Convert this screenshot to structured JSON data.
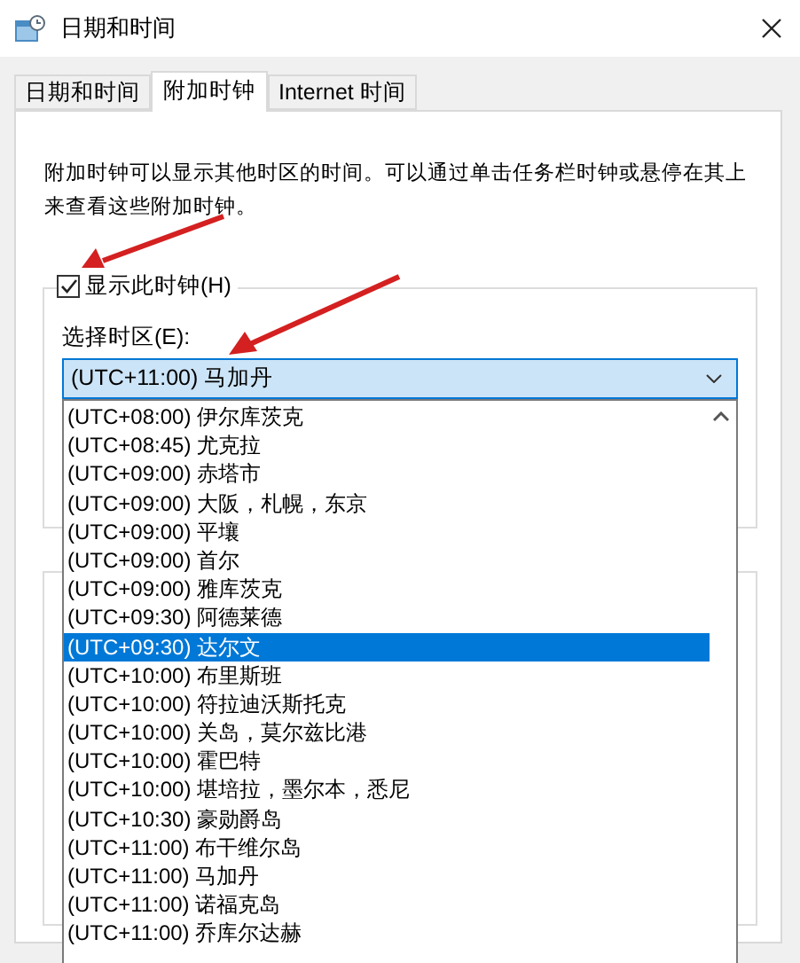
{
  "window": {
    "title": "日期和时间"
  },
  "tabs": [
    {
      "label": "日期和时间",
      "selected": false
    },
    {
      "label": "附加时钟",
      "selected": true
    },
    {
      "label": "Internet 时间",
      "selected": false
    }
  ],
  "description": "附加时钟可以显示其他时区的时间。可以通过单击任务栏时钟或悬停在其上来查看这些附加时钟。",
  "clock_group": {
    "checkbox": {
      "label": "显示此时钟(H)",
      "checked": true
    },
    "timezone_label": "选择时区(E):",
    "timezone_value": "(UTC+11:00) 马加丹"
  },
  "timezone_list": [
    {
      "label": "(UTC+08:00) 伊尔库茨克",
      "selected": false
    },
    {
      "label": "(UTC+08:45) 尤克拉",
      "selected": false
    },
    {
      "label": "(UTC+09:00) 赤塔市",
      "selected": false
    },
    {
      "label": "(UTC+09:00) 大阪，札幌，东京",
      "selected": false
    },
    {
      "label": "(UTC+09:00) 平壤",
      "selected": false
    },
    {
      "label": "(UTC+09:00) 首尔",
      "selected": false
    },
    {
      "label": "(UTC+09:00) 雅库茨克",
      "selected": false
    },
    {
      "label": "(UTC+09:30) 阿德莱德",
      "selected": false
    },
    {
      "label": "(UTC+09:30) 达尔文",
      "selected": true
    },
    {
      "label": "(UTC+10:00) 布里斯班",
      "selected": false
    },
    {
      "label": "(UTC+10:00) 符拉迪沃斯托克",
      "selected": false
    },
    {
      "label": "(UTC+10:00) 关岛，莫尔兹比港",
      "selected": false
    },
    {
      "label": "(UTC+10:00) 霍巴特",
      "selected": false
    },
    {
      "label": "(UTC+10:00) 堪培拉，墨尔本，悉尼",
      "selected": false
    },
    {
      "label": "(UTC+10:30) 豪勋爵岛",
      "selected": false
    },
    {
      "label": "(UTC+11:00) 布干维尔岛",
      "selected": false
    },
    {
      "label": "(UTC+11:00) 马加丹",
      "selected": false
    },
    {
      "label": "(UTC+11:00) 诺福克岛",
      "selected": false
    },
    {
      "label": "(UTC+11:00) 乔库尔达赫",
      "selected": false
    }
  ]
}
